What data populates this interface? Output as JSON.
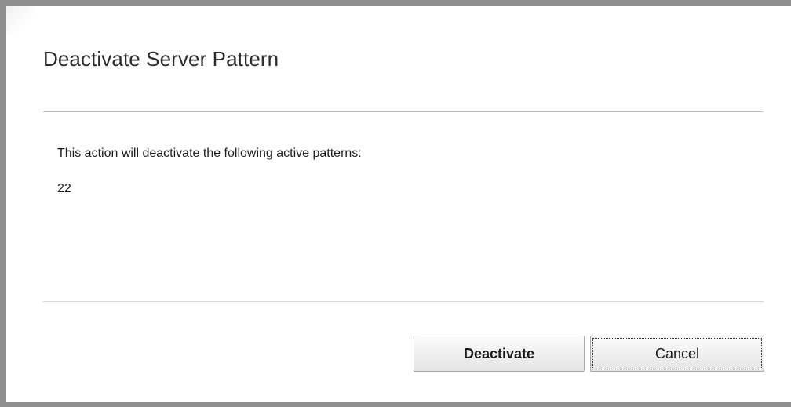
{
  "dialog": {
    "title": "Deactivate Server Pattern",
    "message": "This action will deactivate the following active patterns:",
    "patterns": [
      "22"
    ]
  },
  "buttons": {
    "deactivate_label": "Deactivate",
    "cancel_label": "Cancel"
  },
  "colors": {
    "frame_border": "#8f8f8f",
    "divider": "#bdbdbd",
    "button_border": "#a9a9a9",
    "text": "#1e1e1e"
  }
}
